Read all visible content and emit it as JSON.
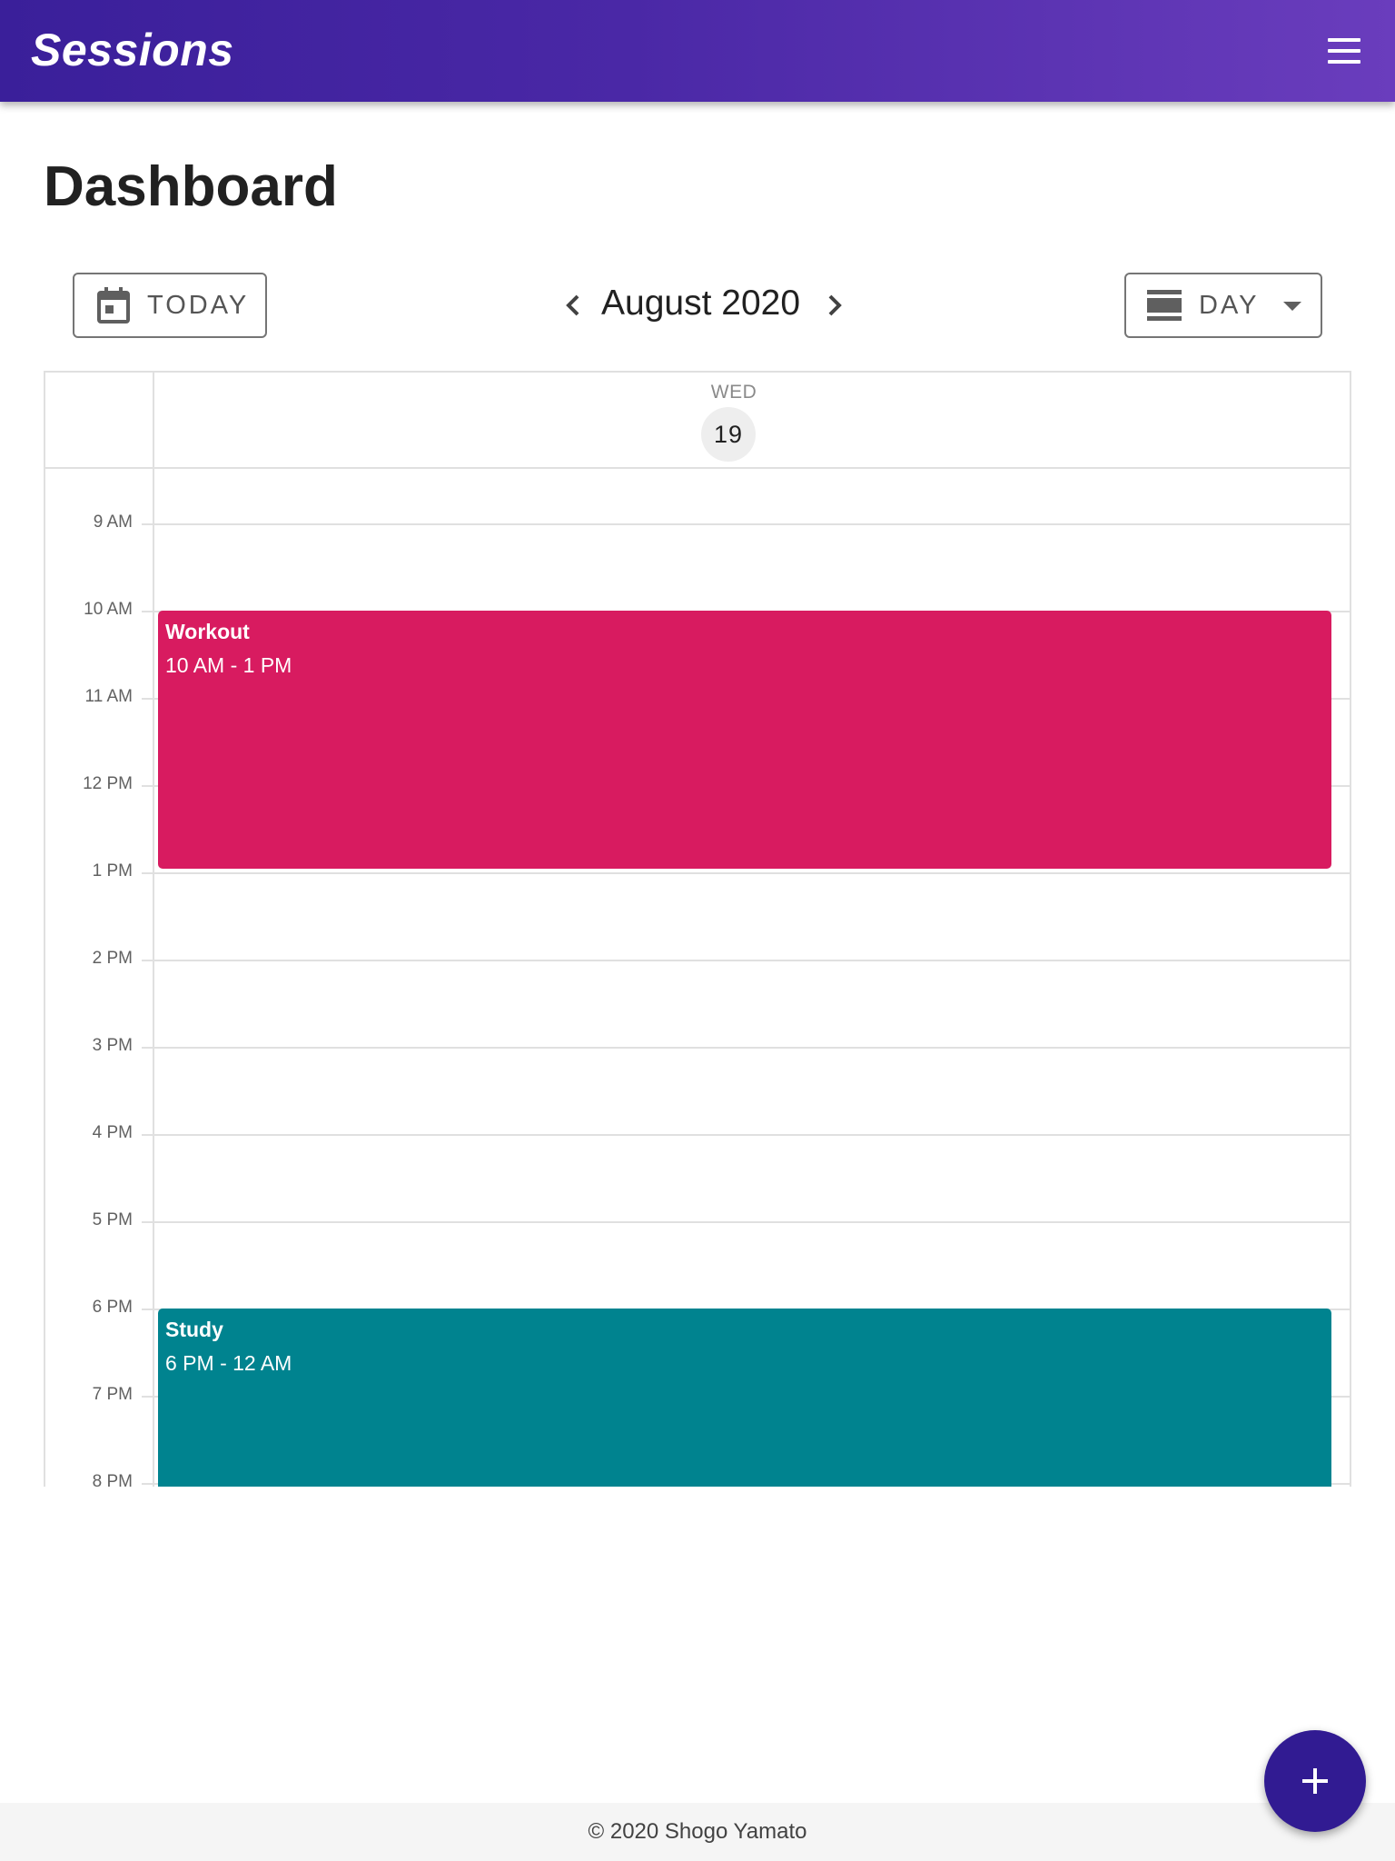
{
  "app": {
    "title": "Sessions"
  },
  "page": {
    "title": "Dashboard"
  },
  "toolbar": {
    "today_label": "TODAY",
    "month_label": "August 2020",
    "view_label": "DAY"
  },
  "calendar": {
    "day": {
      "weekday": "WED",
      "date": "19"
    },
    "hours": [
      "9 AM",
      "10 AM",
      "11 AM",
      "12 PM",
      "1 PM",
      "2 PM",
      "3 PM",
      "4 PM",
      "5 PM",
      "6 PM",
      "7 PM",
      "8 PM"
    ],
    "events": [
      {
        "title": "Workout",
        "time": "10 AM - 1 PM",
        "color": "#d81b60"
      },
      {
        "title": "Study",
        "time": "6 PM - 12 AM",
        "color": "#00838f"
      }
    ]
  },
  "footer": {
    "text": "© 2020 Shogo Yamato"
  },
  "icons": {
    "menu": "menu-icon",
    "calendar": "calendar-today-icon",
    "prev": "chevron-left-icon",
    "next": "chevron-right-icon",
    "view": "view-day-icon",
    "dropdown": "arrow-drop-down-icon",
    "add": "plus-icon"
  },
  "colors": {
    "accent": "#311b92",
    "appbar_start": "#3a1f9a",
    "appbar_end": "#6a3dbd"
  }
}
